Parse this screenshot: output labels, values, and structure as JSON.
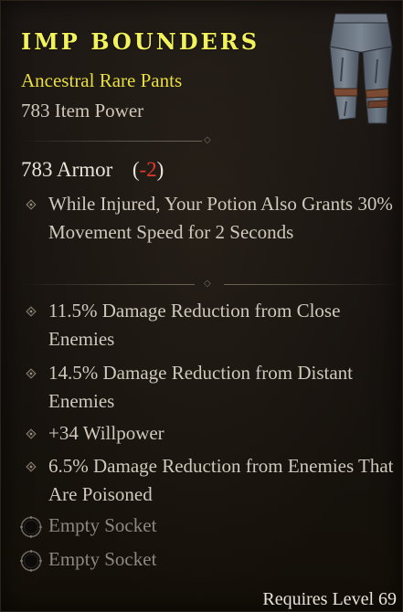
{
  "item": {
    "name": "IMP BOUNDERS",
    "type": "Ancestral Rare Pants",
    "item_power": "783 Item Power",
    "image_icon": "pants-icon"
  },
  "armor": {
    "label": "783 Armor",
    "delta_open": "(",
    "delta": "-2",
    "delta_close": ")"
  },
  "implicit": [
    {
      "text": "While Injured, Your Potion Also Grants 30% Movement Speed for 2 Seconds"
    }
  ],
  "affixes": [
    {
      "text": "11.5% Damage Reduction from Close Enemies"
    },
    {
      "text": "14.5% Damage Reduction from Distant Enemies"
    },
    {
      "text": "+34 Willpower"
    },
    {
      "text": "6.5% Damage Reduction from Enemies That Are Poisoned"
    }
  ],
  "sockets": [
    {
      "label": "Empty Socket"
    },
    {
      "label": "Empty Socket"
    }
  ],
  "requirement": "Requires Level 69",
  "colors": {
    "name": "#f2f25a",
    "rarity": "#e8de3e",
    "negative": "#e0392b",
    "affix_text": "#cfc9bd",
    "socket_text": "#8e887e"
  }
}
